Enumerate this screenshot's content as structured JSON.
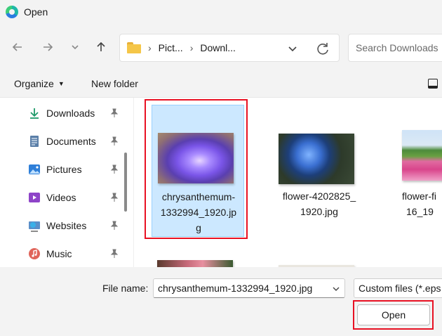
{
  "window": {
    "title": "Open",
    "icon": "edge-icon"
  },
  "nav": {
    "back_icon": "arrow-left-icon",
    "forward_icon": "arrow-right-icon",
    "recent_icon": "chevron-down-icon",
    "up_icon": "arrow-up-icon",
    "breadcrumbs": [
      "Pict...",
      "Downl..."
    ],
    "refresh_icon": "refresh-icon",
    "search_placeholder": "Search Downloads"
  },
  "toolbar": {
    "organize_label": "Organize",
    "new_folder_label": "New folder"
  },
  "sidebar": {
    "items": [
      {
        "label": "Downloads",
        "icon": "download-icon",
        "pinned": true
      },
      {
        "label": "Documents",
        "icon": "document-icon",
        "pinned": true
      },
      {
        "label": "Pictures",
        "icon": "pictures-icon",
        "pinned": true
      },
      {
        "label": "Videos",
        "icon": "videos-icon",
        "pinned": true
      },
      {
        "label": "Websites",
        "icon": "globe-icon",
        "pinned": true
      },
      {
        "label": "Music",
        "icon": "music-icon",
        "pinned": true
      }
    ]
  },
  "files": [
    {
      "name": "chrysanthemum-1332994_1920.jpg",
      "name_lines": [
        "chrysanthemum-",
        "1332994_1920.jp",
        "g"
      ],
      "selected": true
    },
    {
      "name": "flower-4202825_1920.jpg",
      "name_lines": [
        "flower-4202825_",
        "1920.jpg"
      ],
      "selected": false
    },
    {
      "name": "flower-fi...16_19...",
      "name_lines": [
        "flower-fi",
        "16_19"
      ],
      "selected": false
    }
  ],
  "bottom": {
    "file_name_label": "File name:",
    "file_name_value": "chrysanthemum-1332994_1920.jpg",
    "file_type": "Custom files (*.eps",
    "open_label": "Open"
  },
  "colors": {
    "selection_bg": "#cce8ff",
    "highlight_border": "#e81123",
    "folder": "#f5c648"
  }
}
